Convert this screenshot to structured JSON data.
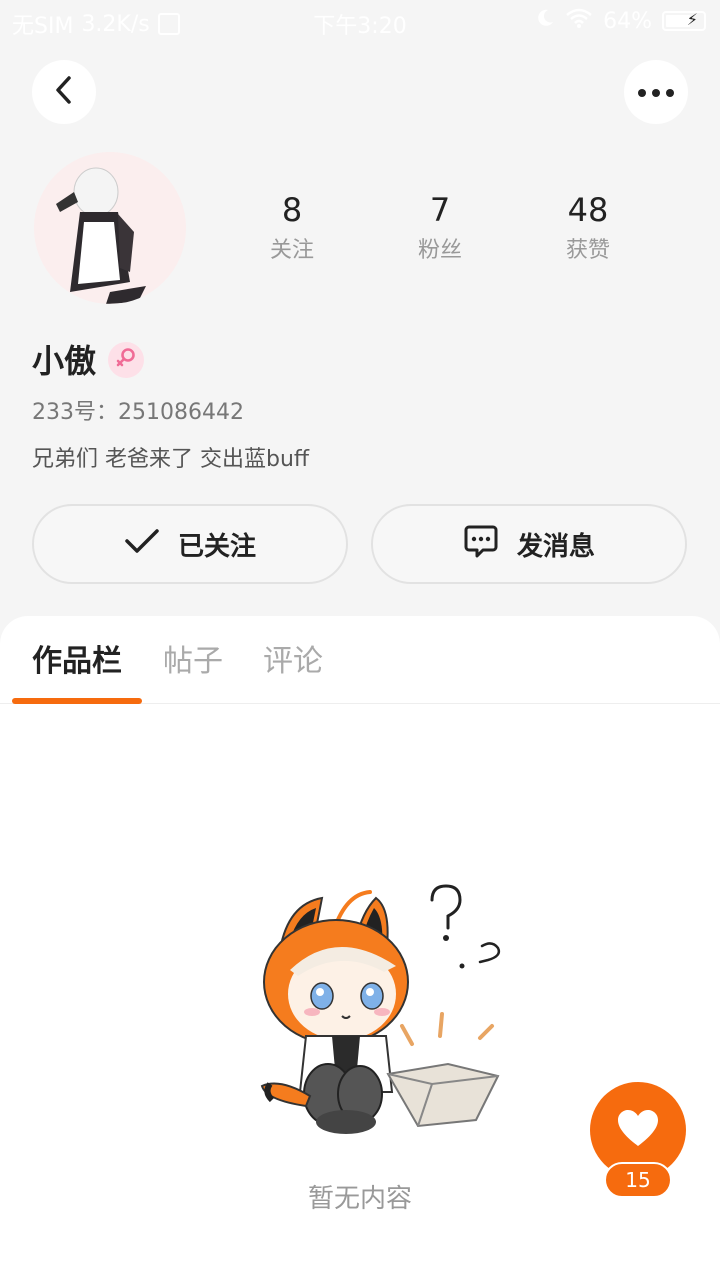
{
  "status_bar": {
    "carrier": "无SIM",
    "speed": "3.2K/s",
    "time": "下午3:20",
    "battery": "64%"
  },
  "profile": {
    "name": "小傲",
    "uid": "233号：251086442",
    "bio": "兄弟们 老爸来了 交出蓝buff",
    "gender": "female"
  },
  "stats": [
    {
      "value": "8",
      "label": "关注"
    },
    {
      "value": "7",
      "label": "粉丝"
    },
    {
      "value": "48",
      "label": "获赞"
    }
  ],
  "actions": {
    "follow_label": "已关注",
    "message_label": "发消息"
  },
  "tabs": [
    {
      "label": "作品栏",
      "active": true
    },
    {
      "label": "帖子",
      "active": false
    },
    {
      "label": "评论",
      "active": false
    }
  ],
  "empty": {
    "text": "暂无内容"
  },
  "fab": {
    "count": "15"
  },
  "colors": {
    "accent": "#f66b0e",
    "background": "#f5f5f5",
    "pink": "#f06b96"
  },
  "icons": [
    "back-arrow-icon",
    "more-dots-icon",
    "female-icon",
    "check-icon",
    "chat-bubble-icon",
    "heart-icon",
    "wifi-icon",
    "moon-icon"
  ]
}
